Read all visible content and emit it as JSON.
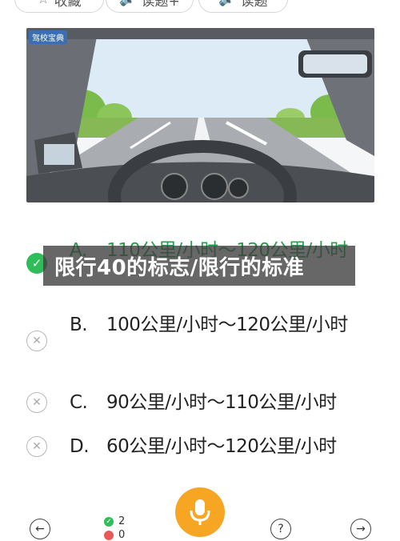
{
  "top_buttons": {
    "collect": "收藏",
    "voice1": "读题+",
    "voice2": "读题"
  },
  "scene": {
    "logo_text": "驾校宝典"
  },
  "options": [
    {
      "letter": "A.",
      "text": "110公里/小时～120公里/小时",
      "state": "correct"
    },
    {
      "letter": "B.",
      "text": "100公里/小时～120公里/小时",
      "state": "wrong"
    },
    {
      "letter": "C.",
      "text": "90公里/小时～110公里/小时",
      "state": "wrong"
    },
    {
      "letter": "D.",
      "text": "60公里/小时～120公里/小时",
      "state": "wrong"
    }
  ],
  "overlay_title": "限行40的标志/限行的标准",
  "stats": {
    "correct_count": "2",
    "wrong_count": "0"
  },
  "colors": {
    "correct": "#2ebd59",
    "mic": "#f6a623"
  }
}
